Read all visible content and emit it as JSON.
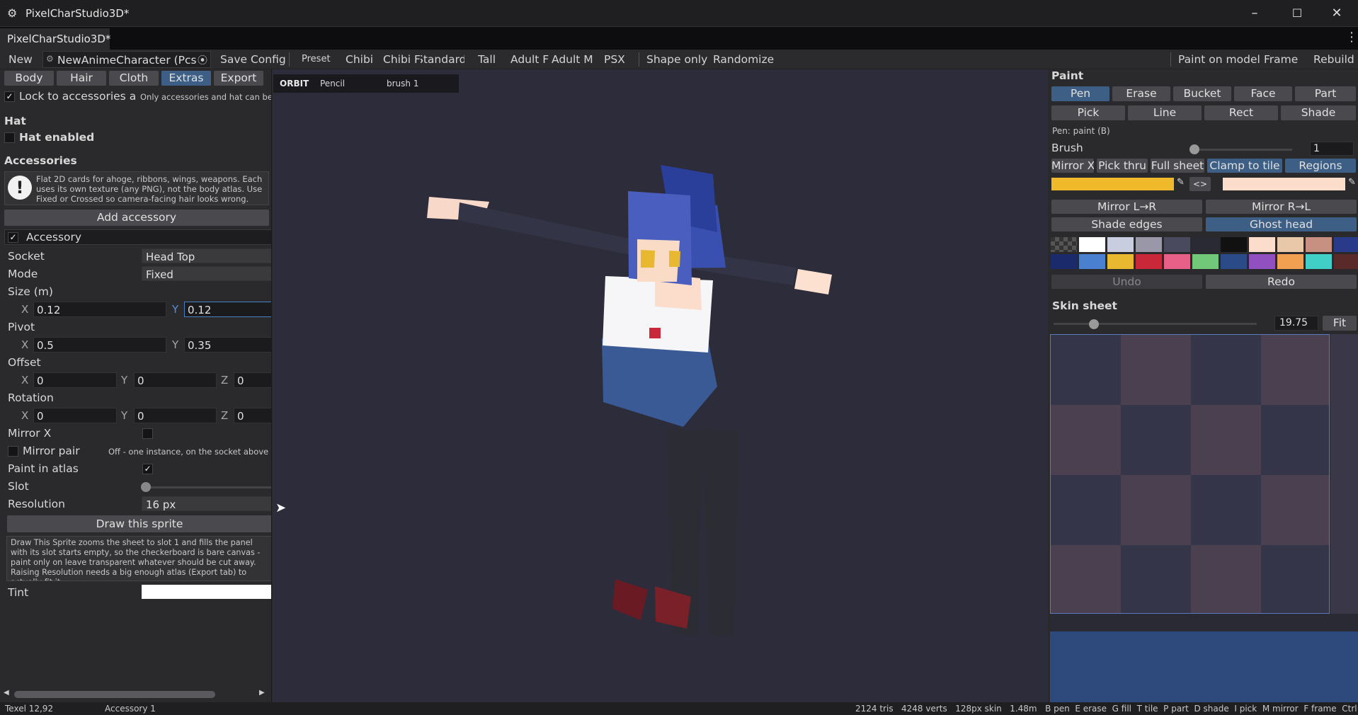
{
  "window": {
    "title": "PixelCharStudio3D*"
  },
  "tab": {
    "label": "PixelCharStudio3D*"
  },
  "toolbar": {
    "new": "New",
    "preset_name": "NewAnimeCharacter (Pcs C",
    "save": "Save Config",
    "preset": "Preset",
    "presets": [
      "Chibi",
      "Chibi F",
      "Standard",
      "Tall",
      "Adult F",
      "Adult M",
      "PSX"
    ],
    "shape_only": "Shape only",
    "randomize": "Randomize",
    "paint_on_model": "Paint on model",
    "frame": "Frame",
    "rebuild": "Rebuild"
  },
  "left": {
    "tabs": [
      "Body",
      "Hair",
      "Cloth",
      "Extras",
      "Export"
    ],
    "lock_label": "Lock to accessories and",
    "lock_hint": "Only accessories and hat can be",
    "hat_header": "Hat",
    "hat_enabled": "Hat enabled",
    "accessories_header": "Accessories",
    "info_text": "Flat 2D cards for ahoge, ribbons, wings, weapons. Each uses its own texture (any PNG), not the body atlas. Use Fixed or Crossed so camera-facing hair looks wrong.",
    "add_accessory": "Add accessory",
    "accessory_title": "Accessory",
    "socket_label": "Socket",
    "socket_value": "Head Top",
    "mode_label": "Mode",
    "mode_value": "Fixed",
    "size_label": "Size (m)",
    "size_x": "0.12",
    "size_y": "0.12",
    "pivot_label": "Pivot",
    "pivot_x": "0.5",
    "pivot_y": "0.35",
    "offset_label": "Offset",
    "offset_x": "0",
    "offset_y": "0",
    "offset_z": "0",
    "rotation_label": "Rotation",
    "rot_x": "0",
    "rot_y": "0",
    "rot_z": "0",
    "mirror_x_label": "Mirror X",
    "mirror_pair_label": "Mirror pair",
    "mirror_pair_hint": "Off - one instance, on the socket above",
    "paint_atlas_label": "Paint in atlas",
    "slot_label": "Slot",
    "resolution_label": "Resolution",
    "resolution_value": "16 px",
    "draw_sprite": "Draw this sprite",
    "draw_help": "Draw This Sprite zooms the sheet to slot 1 and fills the panel with its slot starts empty, so the checkerboard is bare canvas - paint only on leave transparent whatever should be cut away. Raising Resolution needs a big enough atlas (Export tab) to actually fit it.",
    "tint_label": "Tint",
    "axis_x": "X",
    "axis_y": "Y",
    "axis_z": "Z"
  },
  "viewport": {
    "mode": "ORBIT",
    "tool": "Pencil",
    "brush": "brush 1"
  },
  "right": {
    "paint_header": "Paint",
    "tools_row1": [
      "Pen",
      "Erase",
      "Bucket",
      "Face",
      "Part"
    ],
    "tools_row2": [
      "Pick",
      "Line",
      "Rect",
      "Shade"
    ],
    "tool_hint": "Pen: paint (B)",
    "brush_label": "Brush",
    "brush_value": "1",
    "brush_level": 0.05,
    "opts": [
      "Mirror X",
      "Pick thru",
      "Full sheet",
      "Clamp to tile",
      "Regions"
    ],
    "swap": "<>",
    "primary_color": "#f0b92a",
    "secondary_color": "#fcdcca",
    "mirror_lr": "Mirror L→R",
    "mirror_rl": "Mirror R→L",
    "shade_edges": "Shade edges",
    "ghost_head": "Ghost head",
    "palette": [
      "#ffffff",
      "#c8cde0",
      "#9a98a8",
      "#4a4a5e",
      "#2a2a34",
      "#111111",
      "#fcdcca",
      "#e8c8a8",
      "#c89080",
      "#2a3a8a",
      "#1a2a6a",
      "#4a80d0",
      "#e8b830",
      "#c82838",
      "#e86088",
      "#70c878",
      "#2a4a88",
      "#9050c0",
      "#f0a050",
      "#40d0c8",
      "#5a2a2a"
    ],
    "undo": "Undo",
    "redo": "Redo",
    "skin_header": "Skin sheet",
    "zoom": "19.75",
    "fit": "Fit",
    "zoom_level": 0.2
  },
  "status": {
    "texel": "Texel 12,92",
    "selection": "Accessory 1",
    "stats": "2124 tris   4248 verts   128px skin   1.48m   B pen  E erase  G fill  T tile  P part  D shade  I pick  M mirror  F frame  Ctrl+Z undo"
  }
}
